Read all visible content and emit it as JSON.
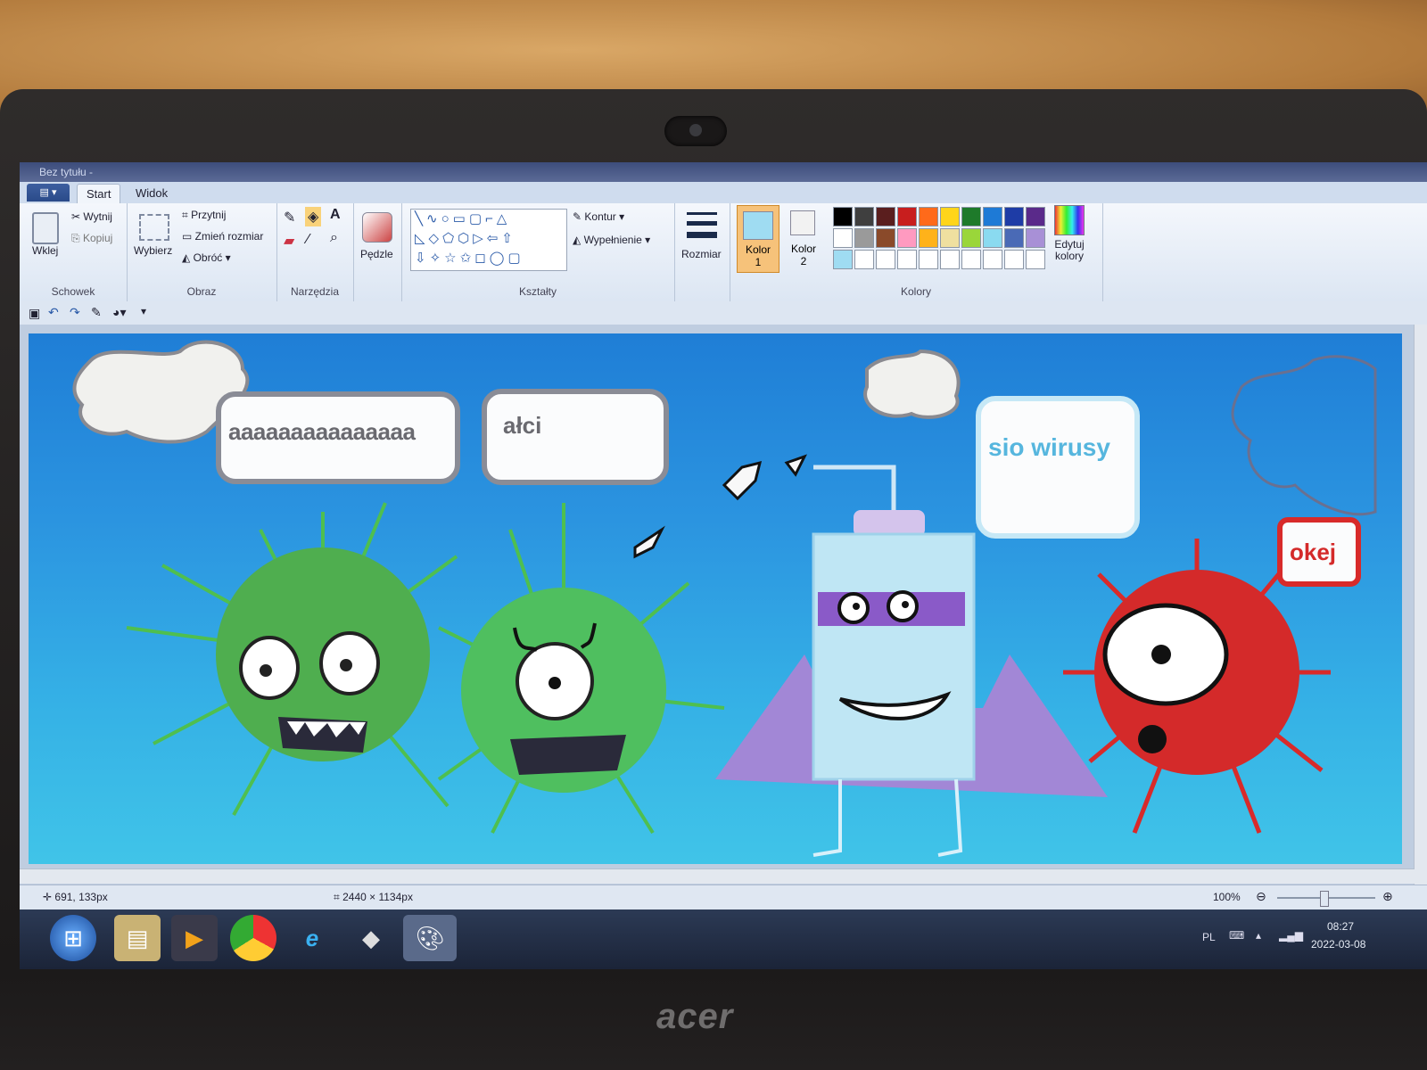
{
  "window": {
    "title": "Bez tytułu - "
  },
  "tabs": {
    "file": "▤ ▾",
    "start": "Start",
    "view": "Widok"
  },
  "clipboard": {
    "paste": "Wklej",
    "cut": "Wytnij",
    "copy": "Kopiuj",
    "group": "Schowek"
  },
  "image": {
    "select": "Wybierz",
    "crop": "Przytnij",
    "resize": "Zmień rozmiar",
    "rotate": "Obróć",
    "group": "Obraz"
  },
  "tools": {
    "group": "Narzędzia"
  },
  "brushes": {
    "label": "Pędzle"
  },
  "shapes": {
    "outline": "Kontur",
    "fill": "Wypełnienie",
    "group": "Kształty"
  },
  "size": {
    "label": "Rozmiar"
  },
  "colors": {
    "color1_label": "Kolor",
    "color1_num": "1",
    "color1_value": "#9fdcf2",
    "color2_label": "Kolor",
    "color2_num": "2",
    "color2_value": "#f2f2f2",
    "edit": "Edytuj kolory",
    "group": "Kolory",
    "palette_row1": [
      "#000000",
      "#3f3f3f",
      "#5a1e1e",
      "#c81e1e",
      "#ff6a1a",
      "#ffd51a",
      "#1e7a2a",
      "#1e7ad6",
      "#1e3ca6",
      "#5a2a8a"
    ],
    "palette_row2": [
      "#ffffff",
      "#9a9a9a",
      "#8a4a2a",
      "#ff9ac0",
      "#ffb21a",
      "#efe0a0",
      "#9ad63a",
      "#8adaf0",
      "#4a6ab6",
      "#a890d6"
    ],
    "palette_row3": [
      "#9fdcf2",
      "#ffffff",
      "#ffffff",
      "#ffffff",
      "#ffffff",
      "#ffffff",
      "#ffffff",
      "#ffffff",
      "#ffffff",
      "#ffffff"
    ]
  },
  "drawing": {
    "bubble1": "aaaaaaaaaaaaaaa",
    "bubble2": "ałci",
    "bubble3": "sio wirusy",
    "bubble4": "okej"
  },
  "status": {
    "cursor": "691, 133px",
    "dimensions": "2440 × 1134px",
    "zoom": "100%"
  },
  "taskbar": {
    "lang": "PL",
    "time": "08:27",
    "date": "2022-03-08"
  },
  "brand": "acer"
}
